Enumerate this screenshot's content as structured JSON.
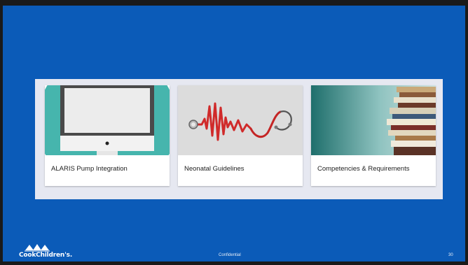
{
  "cards": [
    {
      "title": "ALARIS Pump Integration",
      "image": "computer-monitor-icon"
    },
    {
      "title": "Neonatal Guidelines",
      "image": "stethoscope-heartbeat-image"
    },
    {
      "title": "Competencies & Requirements",
      "image": "book-stack-image"
    }
  ],
  "footer": {
    "logo_text": "CookChildren's.",
    "confidential": "Confidential",
    "page_number": "30"
  },
  "colors": {
    "slide_background": "#0b5bb8",
    "panel_background": "#e6e8f1",
    "teal_accent": "#46b5ad",
    "heartbeat_red": "#d02a2a"
  }
}
